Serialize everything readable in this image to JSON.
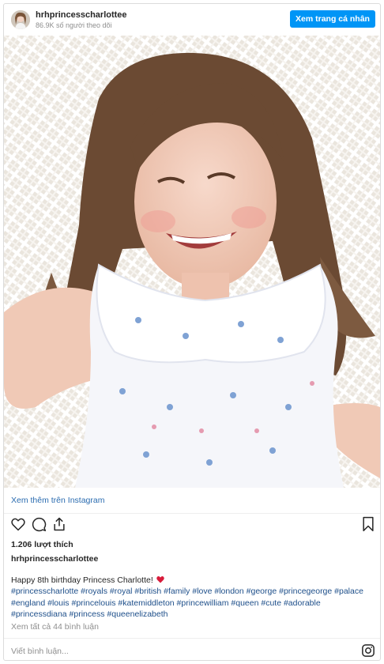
{
  "header": {
    "username": "hrhprincesscharlottee",
    "followers": "86.9K số người theo dõi",
    "profile_button": "Xem trang cá nhân"
  },
  "post": {
    "image_alt": "Smiling girl with long brown hair in a white floral dress sitting in a white wicker chair",
    "view_more": "Xem thêm trên Instagram",
    "likes": "1.206 lượt thích",
    "caption_user": "hrhprincesscharlottee",
    "caption_text": "Happy 8th birthday Princess Charlotte!",
    "hashtags": "#princesscharlotte #royals #royal #british #family #love #london #george #princegeorge #palace #england #louis #princelouis #katemiddleton #princewilliam #queen #cute #adorable #princessdiana #princess #queenelizabeth",
    "view_comments": "Xem tất cả 44 bình luận",
    "comment_placeholder": "Viết bình luận..."
  },
  "icons": [
    "heart-icon",
    "comment-icon",
    "share-icon",
    "bookmark-icon",
    "instagram-icon",
    "red-heart-emoji"
  ],
  "colors": {
    "button": "#0095f6",
    "link": "#1e4f8a",
    "heart": "#ed4956"
  }
}
